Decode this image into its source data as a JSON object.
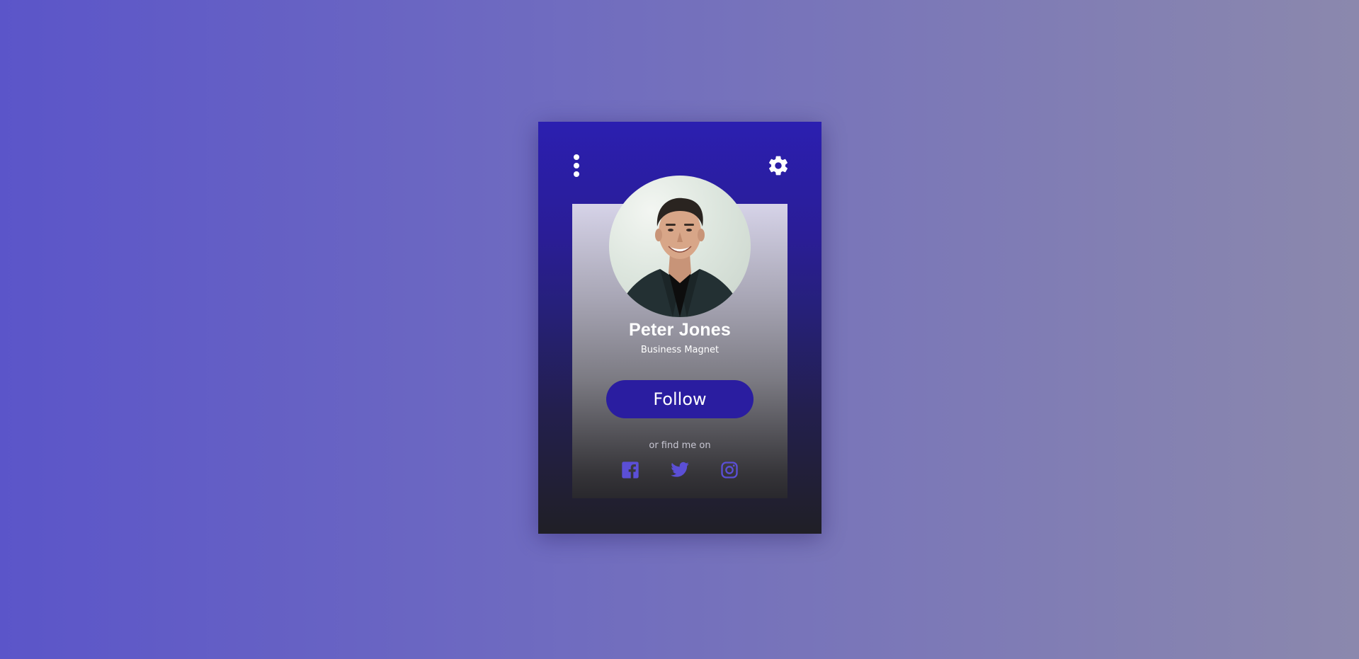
{
  "profile": {
    "name": "Peter Jones",
    "title": "Business Magnet",
    "avatar_alt": "Peter Jones"
  },
  "actions": {
    "follow_label": "Follow",
    "find_text": "or find me on"
  },
  "social": [
    {
      "name": "facebook",
      "icon": "facebook-icon"
    },
    {
      "name": "twitter",
      "icon": "twitter-icon"
    },
    {
      "name": "instagram",
      "icon": "instagram-icon"
    }
  ],
  "icons": {
    "menu": "more-vertical-icon",
    "settings": "gear-icon"
  },
  "colors": {
    "background_left": "#5b55c9",
    "background_right": "#8b88ad",
    "card_top": "#2b1fb0",
    "card_bottom": "#201f26",
    "accent": "#2a1da0",
    "social_icon": "#5b4fd6",
    "text": "#ffffff"
  }
}
